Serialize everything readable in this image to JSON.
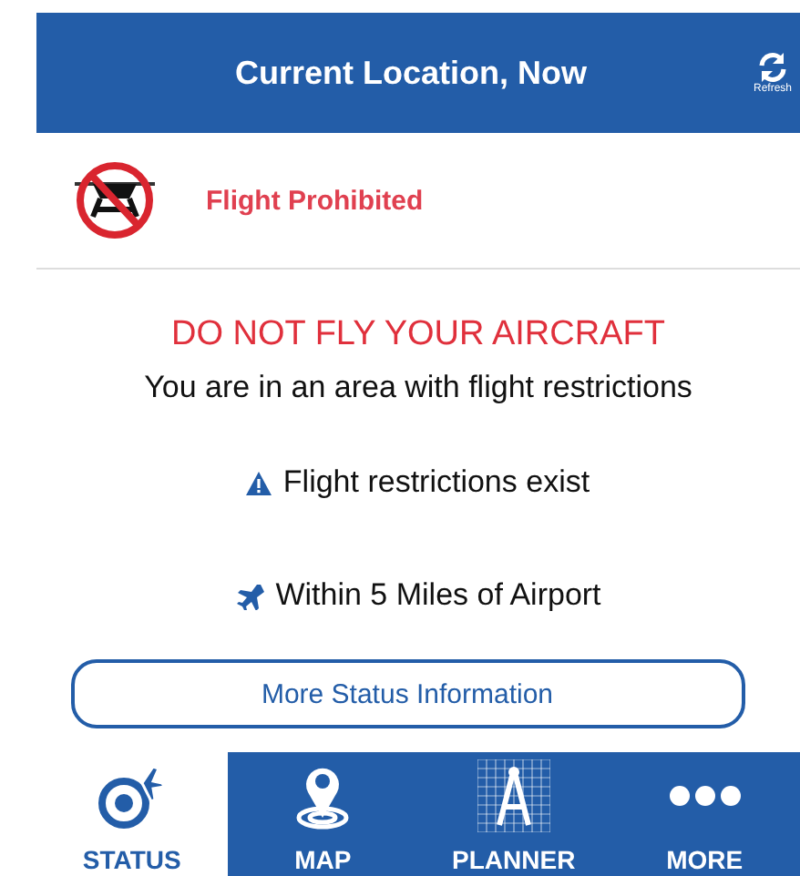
{
  "header": {
    "title": "Current Location, Now",
    "refresh_label": "Refresh"
  },
  "status": {
    "label": "Flight Prohibited"
  },
  "warning": {
    "heading": "DO NOT FLY YOUR AIRCRAFT",
    "message": "You are in an area with flight restrictions"
  },
  "notices": [
    {
      "kind": "warning",
      "text": "Flight restrictions exist"
    },
    {
      "kind": "airport",
      "text": "Within 5 Miles of Airport"
    }
  ],
  "more_button": "More Status Information",
  "tabs": [
    {
      "kind": "status",
      "label": "STATUS",
      "selected": true
    },
    {
      "kind": "map",
      "label": "MAP",
      "selected": false
    },
    {
      "kind": "planner",
      "label": "PLANNER",
      "selected": false
    },
    {
      "kind": "more",
      "label": "MORE",
      "selected": false
    }
  ]
}
